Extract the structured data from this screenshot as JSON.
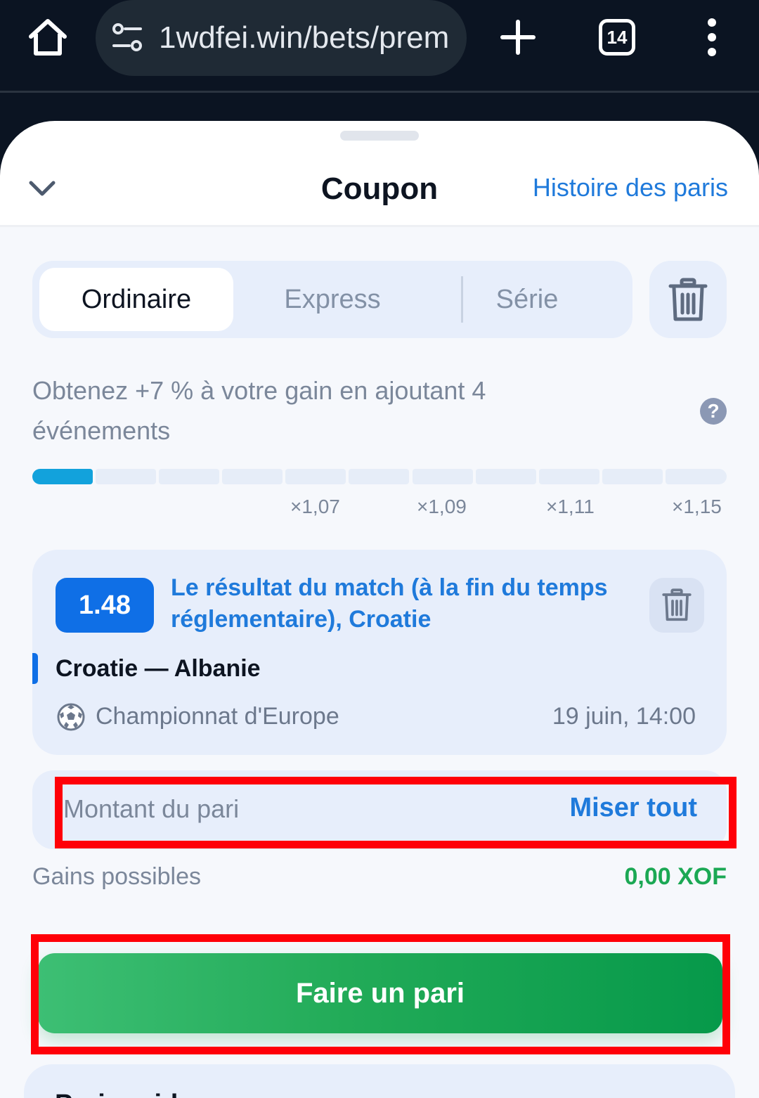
{
  "browser": {
    "url": "1wdfei.win/bets/prem",
    "tab_count": "14",
    "icons": [
      "home-icon",
      "site-settings-icon",
      "new-tab-icon",
      "tabs-icon",
      "more-menu-icon"
    ]
  },
  "coupon": {
    "title": "Coupon",
    "history_link": "Histoire des paris",
    "tabs": [
      {
        "label": "Ordinaire",
        "active": true
      },
      {
        "label": "Express",
        "active": false
      },
      {
        "label": "Série",
        "active": false
      }
    ],
    "promo": {
      "text": "Obtenez +7 % à votre gain en ajoutant 4 événements",
      "progress_filled_segments": 1,
      "total_segments": 11,
      "multipliers": [
        "×1,07",
        "×1,09",
        "×1,11",
        "×1,15"
      ]
    },
    "bet": {
      "odds": "1.48",
      "market": "Le résultat du match (à la fin du temps réglementaire), Croatie",
      "match": "Croatie — Albanie",
      "league": "Championnat d'Europe",
      "datetime": "19 juin, 14:00"
    },
    "stake": {
      "placeholder": "Montant du pari",
      "all_in_label": "Miser tout"
    },
    "gains": {
      "label": "Gains possibles",
      "value": "0,00 XOF"
    },
    "submit_label": "Faire un pari",
    "next_section_title": "Pari rapide"
  },
  "colors": {
    "accent_blue": "#1f7adb",
    "odds_blue": "#0f6fe6",
    "green": "#1ba854",
    "highlight_red": "#ff0008"
  }
}
